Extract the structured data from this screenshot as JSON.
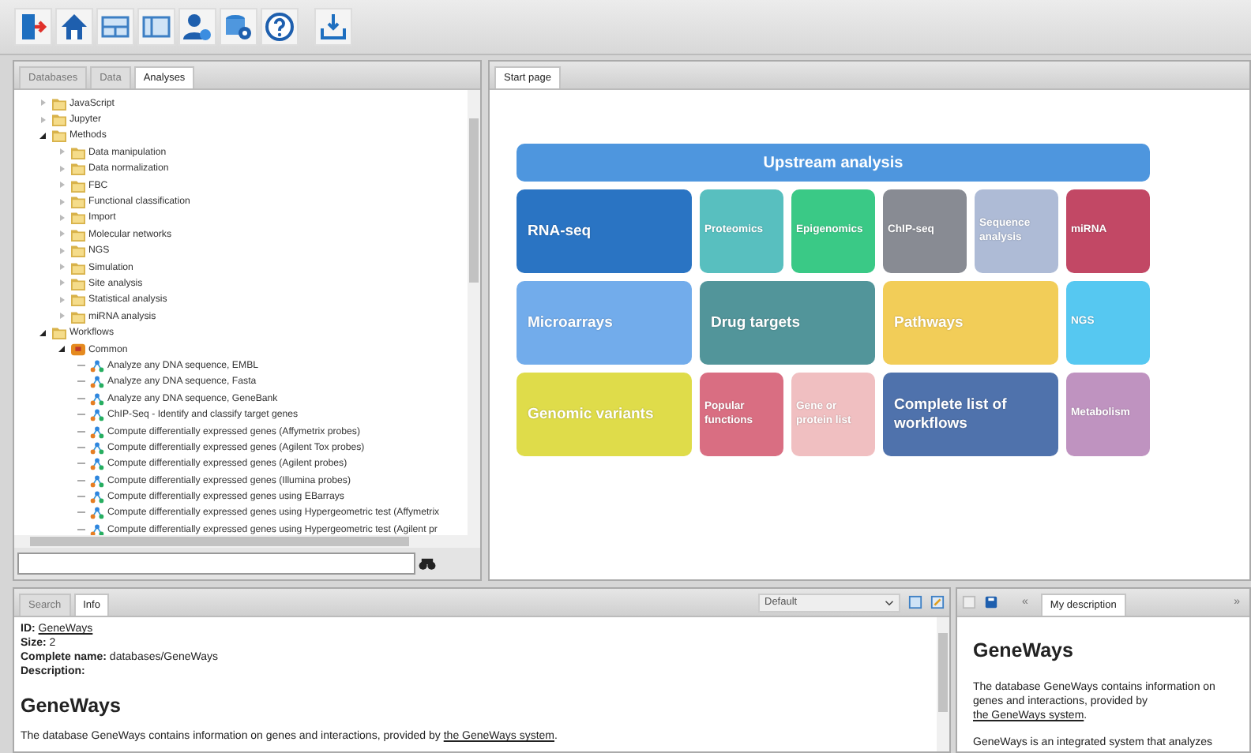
{
  "left_panel": {
    "tabs": [
      {
        "label": "Databases",
        "selected": false
      },
      {
        "label": "Data",
        "selected": false
      },
      {
        "label": "Analyses",
        "selected": true
      }
    ],
    "tree": [
      {
        "label": "JavaScript",
        "kind": "folder",
        "expanded": false
      },
      {
        "label": "Jupyter",
        "kind": "folder",
        "expanded": false
      },
      {
        "label": "Methods",
        "kind": "folder",
        "expanded": true,
        "children": [
          {
            "label": "Data manipulation",
            "kind": "folder",
            "expanded": false
          },
          {
            "label": "Data normalization",
            "kind": "folder",
            "expanded": false
          },
          {
            "label": "FBC",
            "kind": "folder",
            "expanded": false
          },
          {
            "label": "Functional classification",
            "kind": "folder",
            "expanded": false
          },
          {
            "label": "Import",
            "kind": "folder",
            "expanded": false
          },
          {
            "label": "Molecular networks",
            "kind": "folder",
            "expanded": false
          },
          {
            "label": "NGS",
            "kind": "folder",
            "expanded": false
          },
          {
            "label": "Simulation",
            "kind": "folder",
            "expanded": false
          },
          {
            "label": "Site analysis",
            "kind": "folder",
            "expanded": false
          },
          {
            "label": "Statistical analysis",
            "kind": "folder",
            "expanded": false
          },
          {
            "label": "miRNA analysis",
            "kind": "folder",
            "expanded": false
          }
        ]
      },
      {
        "label": "Workflows",
        "kind": "folder",
        "expanded": true,
        "children": [
          {
            "label": "Common",
            "kind": "group",
            "expanded": true,
            "children": [
              {
                "label": "Analyze any DNA sequence, EMBL",
                "kind": "workflow"
              },
              {
                "label": "Analyze any DNA sequence, Fasta",
                "kind": "workflow"
              },
              {
                "label": "Analyze any DNA sequence, GeneBank",
                "kind": "workflow"
              },
              {
                "label": "ChIP-Seq - Identify and classify target genes",
                "kind": "workflow"
              },
              {
                "label": "Compute differentially expressed genes (Affymetrix probes)",
                "kind": "workflow"
              },
              {
                "label": "Compute differentially expressed genes (Agilent Tox probes)",
                "kind": "workflow"
              },
              {
                "label": "Compute differentially expressed genes (Agilent probes)",
                "kind": "workflow"
              },
              {
                "label": "Compute differentially expressed genes (Illumina probes)",
                "kind": "workflow"
              },
              {
                "label": "Compute differentially expressed genes using EBarrays",
                "kind": "workflow"
              },
              {
                "label": "Compute differentially expressed genes using Hypergeometric test (Affymetrix",
                "kind": "workflow"
              },
              {
                "label": "Compute differentially expressed genes using Hypergeometric test (Agilent pr",
                "kind": "workflow"
              }
            ]
          }
        ]
      }
    ]
  },
  "main_panel": {
    "tabs": [
      {
        "label": "Start page",
        "selected": true
      }
    ],
    "header": {
      "label": "Upstream analysis",
      "color": "#4e96de"
    },
    "tiles": [
      {
        "label": "RNA-seq",
        "kind": "wide",
        "color": "#2a74c3"
      },
      {
        "label": "Proteomics",
        "kind": "narrow",
        "color": "#58bfbf"
      },
      {
        "label": "Epigenomics",
        "kind": "narrow",
        "color": "#3ac986"
      },
      {
        "label": "ChIP-seq",
        "kind": "narrow",
        "color": "#888b93"
      },
      {
        "label": "Sequence analysis",
        "kind": "narrow",
        "color": "#aebbd6"
      },
      {
        "label": "miRNA",
        "kind": "narrow",
        "color": "#c24865"
      },
      {
        "label": "Microarrays",
        "kind": "wide",
        "color": "#72aceb"
      },
      {
        "label": "Drug targets",
        "kind": "wide",
        "color": "#52959a"
      },
      {
        "label": "Pathways",
        "kind": "wide",
        "color": "#f2cd58"
      },
      {
        "label": "NGS",
        "kind": "narrow",
        "color": "#56c8f1"
      },
      {
        "label": "Genomic variants",
        "kind": "wide",
        "color": "#dfdc4a"
      },
      {
        "label": "Popular functions",
        "kind": "narrow",
        "color": "#d96e82"
      },
      {
        "label": "Gene or protein list",
        "kind": "narrow",
        "color": "#f0bfc1"
      },
      {
        "label": "Complete list of workflows",
        "kind": "wide",
        "color": "#4f72ac"
      },
      {
        "label": "Metabolism",
        "kind": "narrow",
        "color": "#bf93c0"
      }
    ]
  },
  "info_panel": {
    "tabs": [
      {
        "label": "Search",
        "selected": false
      },
      {
        "label": "Info",
        "selected": true
      }
    ],
    "view_select": {
      "value": "Default"
    },
    "fields": [
      {
        "label": "ID:",
        "value": "GeneWays",
        "link": true
      },
      {
        "label": "Size:",
        "value": "2",
        "link": false
      },
      {
        "label": "Complete name:",
        "value": "databases/GeneWays",
        "link": false
      },
      {
        "label": "Description:"
      }
    ],
    "heading": "GeneWays",
    "paragraph": {
      "text": "The database GeneWays contains information on genes and interactions, provided by ",
      "link": "the GeneWays system",
      "after": "."
    }
  },
  "description_panel": {
    "prev": "«",
    "tabs": [
      {
        "label": "My description",
        "selected": true
      }
    ],
    "next": "»",
    "heading": "GeneWays",
    "paragraph": {
      "text": "The database GeneWays contains information on genes and interactions, provided by ",
      "link": "the GeneWays system",
      "after": "."
    },
    "paragraph_2": "GeneWays is an integrated system that analyzes"
  }
}
